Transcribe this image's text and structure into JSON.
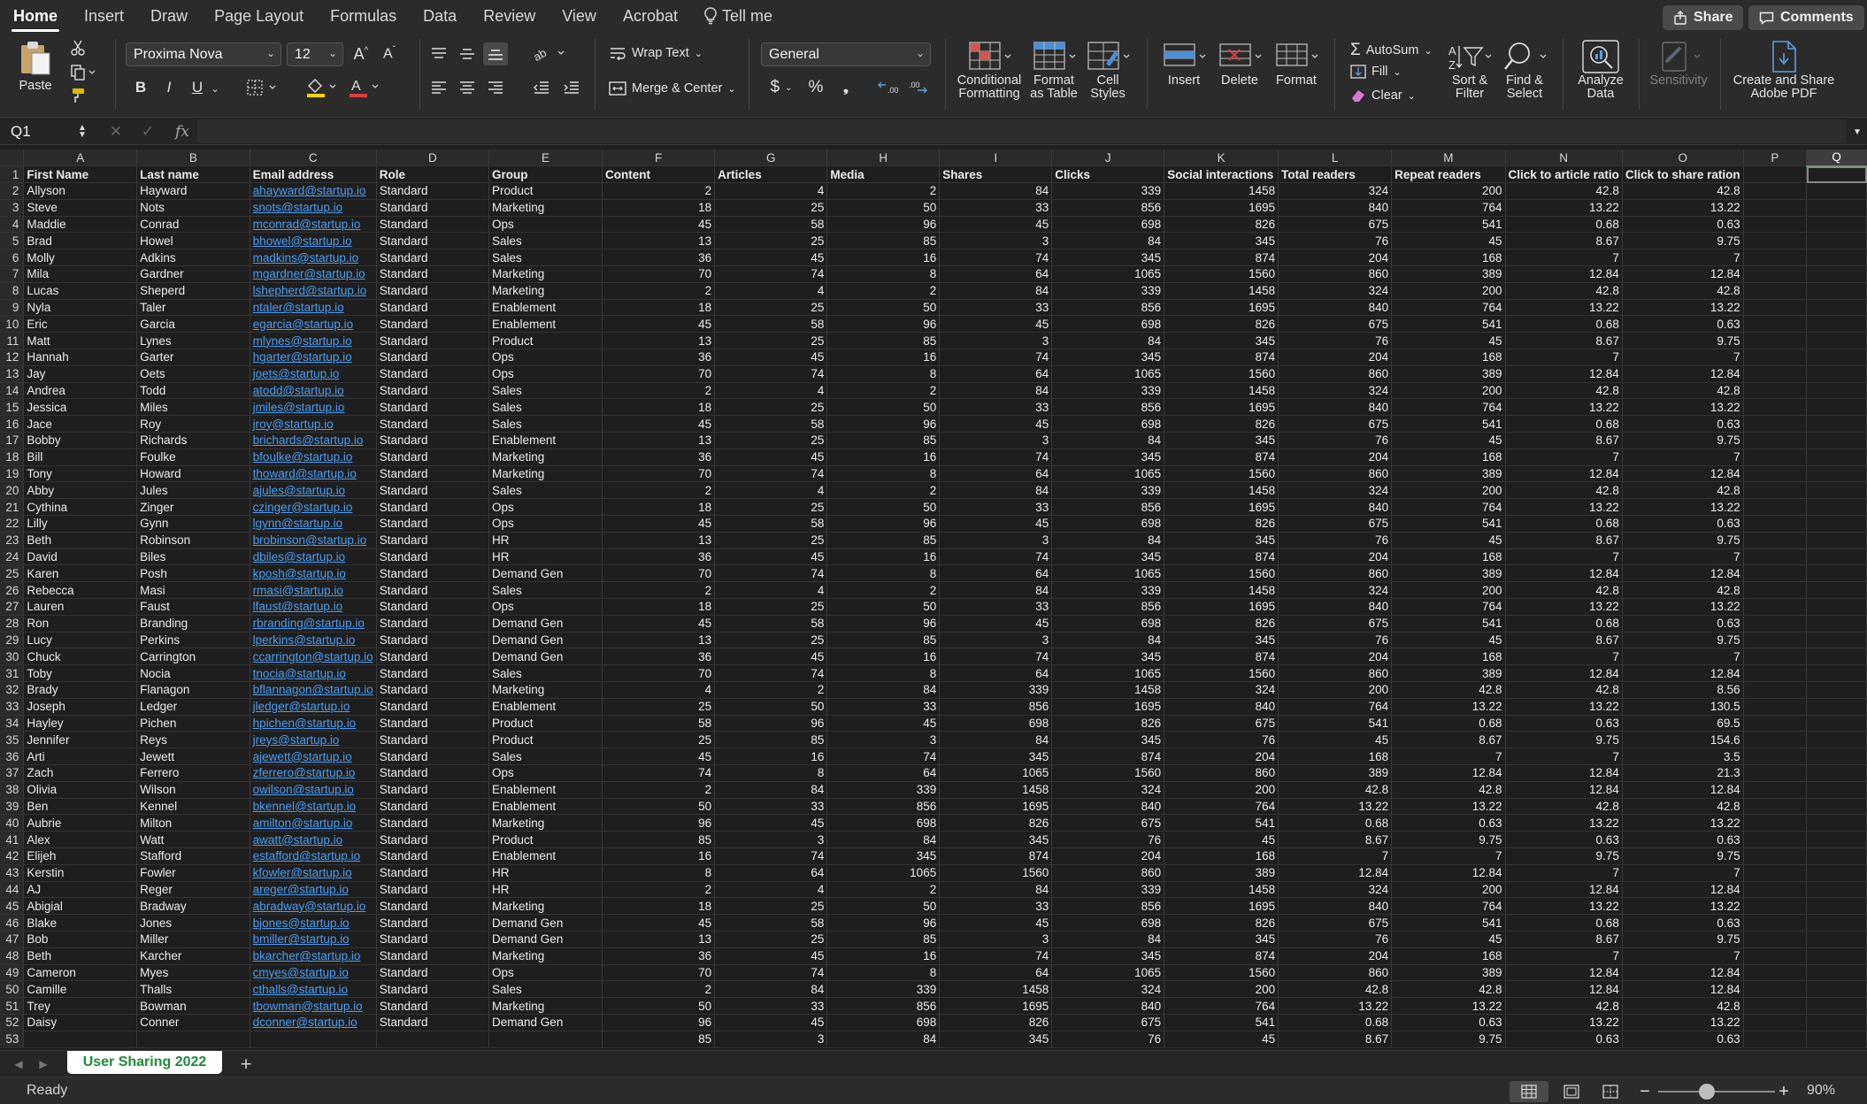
{
  "tabs": [
    "Home",
    "Insert",
    "Draw",
    "Page Layout",
    "Formulas",
    "Data",
    "Review",
    "View",
    "Acrobat"
  ],
  "tell_me": "Tell me",
  "share_label": "Share",
  "comments_label": "Comments",
  "ribbon": {
    "paste": "Paste",
    "font_name": "Proxima Nova",
    "font_size": "12",
    "wrap_text": "Wrap Text",
    "merge_center": "Merge & Center",
    "number_format": "General",
    "conditional": [
      "Conditional",
      "Formatting"
    ],
    "format_table": [
      "Format",
      "as Table"
    ],
    "cell_styles": [
      "Cell",
      "Styles"
    ],
    "insert": "Insert",
    "delete": "Delete",
    "format": "Format",
    "autosum": "AutoSum",
    "fill": "Fill",
    "clear": "Clear",
    "sort_filter": [
      "Sort &",
      "Filter"
    ],
    "find_select": [
      "Find &",
      "Select"
    ],
    "analyze": [
      "Analyze",
      "Data"
    ],
    "sensitivity": "Sensitivity",
    "create_pdf": [
      "Create and Share",
      "Adobe PDF"
    ],
    "bold": "B",
    "italic": "I",
    "underline": "U",
    "currency": "$",
    "percent": "%",
    "comma": "❯"
  },
  "formula_bar": {
    "cell_ref": "Q1",
    "fx": "fx",
    "content": ""
  },
  "columns": [
    "A",
    "B",
    "C",
    "D",
    "E",
    "F",
    "G",
    "H",
    "I",
    "J",
    "K",
    "L",
    "M",
    "N",
    "O",
    "P",
    "Q"
  ],
  "headers": [
    "First Name",
    "Last name",
    "Email address",
    "Role",
    "Group",
    "Content",
    "Articles",
    "Media",
    "Shares",
    "Clicks",
    "Social interactions",
    "Total readers",
    "Repeat readers",
    "Click to article ratio",
    "Click to share ration"
  ],
  "rows": [
    [
      "Allyson",
      "Hayward",
      "ahayward@startup.io",
      "Standard",
      "Product",
      "2",
      "4",
      "2",
      "84",
      "339",
      "1458",
      "324",
      "200",
      "42.8",
      "42.8"
    ],
    [
      "Steve",
      "Nots",
      "snots@startup.io",
      "Standard",
      "Marketing",
      "18",
      "25",
      "50",
      "33",
      "856",
      "1695",
      "840",
      "764",
      "13.22",
      "13.22"
    ],
    [
      "Maddie",
      "Conrad",
      "mconrad@startup.io",
      "Standard",
      "Ops",
      "45",
      "58",
      "96",
      "45",
      "698",
      "826",
      "675",
      "541",
      "0.68",
      "0.63"
    ],
    [
      "Brad",
      "Howel",
      "bhowel@startup.io",
      "Standard",
      "Sales",
      "13",
      "25",
      "85",
      "3",
      "84",
      "345",
      "76",
      "45",
      "8.67",
      "9.75"
    ],
    [
      "Molly",
      "Adkins",
      "madkins@startup.io",
      "Standard",
      "Sales",
      "36",
      "45",
      "16",
      "74",
      "345",
      "874",
      "204",
      "168",
      "7",
      "7"
    ],
    [
      "Mila",
      "Gardner",
      "mgardner@startup.io",
      "Standard",
      "Marketing",
      "70",
      "74",
      "8",
      "64",
      "1065",
      "1560",
      "860",
      "389",
      "12.84",
      "12.84"
    ],
    [
      "Lucas",
      "Sheperd",
      "lshepherd@startup.io",
      "Standard",
      "Marketing",
      "2",
      "4",
      "2",
      "84",
      "339",
      "1458",
      "324",
      "200",
      "42.8",
      "42.8"
    ],
    [
      "Nyla",
      "Taler",
      "ntaler@startup.io",
      "Standard",
      "Enablement",
      "18",
      "25",
      "50",
      "33",
      "856",
      "1695",
      "840",
      "764",
      "13.22",
      "13.22"
    ],
    [
      "Eric",
      "Garcia",
      "egarcia@startup.io",
      "Standard",
      "Enablement",
      "45",
      "58",
      "96",
      "45",
      "698",
      "826",
      "675",
      "541",
      "0.68",
      "0.63"
    ],
    [
      "Matt",
      "Lynes",
      "mlynes@startup.io",
      "Standard",
      "Product",
      "13",
      "25",
      "85",
      "3",
      "84",
      "345",
      "76",
      "45",
      "8.67",
      "9.75"
    ],
    [
      "Hannah",
      "Garter",
      "hgarter@startup.io",
      "Standard",
      "Ops",
      "36",
      "45",
      "16",
      "74",
      "345",
      "874",
      "204",
      "168",
      "7",
      "7"
    ],
    [
      "Jay",
      "Oets",
      "joets@startup.io",
      "Standard",
      "Ops",
      "70",
      "74",
      "8",
      "64",
      "1065",
      "1560",
      "860",
      "389",
      "12.84",
      "12.84"
    ],
    [
      "Andrea",
      "Todd",
      "atodd@startup.io",
      "Standard",
      "Sales",
      "2",
      "4",
      "2",
      "84",
      "339",
      "1458",
      "324",
      "200",
      "42.8",
      "42.8"
    ],
    [
      "Jessica",
      "Miles",
      "jmiles@startup.io",
      "Standard",
      "Sales",
      "18",
      "25",
      "50",
      "33",
      "856",
      "1695",
      "840",
      "764",
      "13.22",
      "13.22"
    ],
    [
      "Jace",
      "Roy",
      "jroy@startup.io",
      "Standard",
      "Sales",
      "45",
      "58",
      "96",
      "45",
      "698",
      "826",
      "675",
      "541",
      "0.68",
      "0.63"
    ],
    [
      "Bobby",
      "Richards",
      "brichards@startup.io",
      "Standard",
      "Enablement",
      "13",
      "25",
      "85",
      "3",
      "84",
      "345",
      "76",
      "45",
      "8.67",
      "9.75"
    ],
    [
      "Bill",
      "Foulke",
      "bfoulke@startup.io",
      "Standard",
      "Marketing",
      "36",
      "45",
      "16",
      "74",
      "345",
      "874",
      "204",
      "168",
      "7",
      "7"
    ],
    [
      "Tony",
      "Howard",
      "thoward@startup.io",
      "Standard",
      "Marketing",
      "70",
      "74",
      "8",
      "64",
      "1065",
      "1560",
      "860",
      "389",
      "12.84",
      "12.84"
    ],
    [
      "Abby",
      "Jules",
      "ajules@startup.io",
      "Standard",
      "Sales",
      "2",
      "4",
      "2",
      "84",
      "339",
      "1458",
      "324",
      "200",
      "42.8",
      "42.8"
    ],
    [
      "Cythina",
      "Zinger",
      "czinger@startup.io",
      "Standard",
      "Ops",
      "18",
      "25",
      "50",
      "33",
      "856",
      "1695",
      "840",
      "764",
      "13.22",
      "13.22"
    ],
    [
      "Lilly",
      "Gynn",
      "lgynn@startup.io",
      "Standard",
      "Ops",
      "45",
      "58",
      "96",
      "45",
      "698",
      "826",
      "675",
      "541",
      "0.68",
      "0.63"
    ],
    [
      "Beth",
      "Robinson",
      "brobinson@startup.io",
      "Standard",
      "HR",
      "13",
      "25",
      "85",
      "3",
      "84",
      "345",
      "76",
      "45",
      "8.67",
      "9.75"
    ],
    [
      "David",
      "Biles",
      "dbiles@startup.io",
      "Standard",
      "HR",
      "36",
      "45",
      "16",
      "74",
      "345",
      "874",
      "204",
      "168",
      "7",
      "7"
    ],
    [
      "Karen",
      "Posh",
      "kposh@startup.io",
      "Standard",
      "Demand Gen",
      "70",
      "74",
      "8",
      "64",
      "1065",
      "1560",
      "860",
      "389",
      "12.84",
      "12.84"
    ],
    [
      "Rebecca",
      "Masi",
      "rmasi@startup.io",
      "Standard",
      "Sales",
      "2",
      "4",
      "2",
      "84",
      "339",
      "1458",
      "324",
      "200",
      "42.8",
      "42.8"
    ],
    [
      "Lauren",
      "Faust",
      "lfaust@startup.io",
      "Standard",
      "Ops",
      "18",
      "25",
      "50",
      "33",
      "856",
      "1695",
      "840",
      "764",
      "13.22",
      "13.22"
    ],
    [
      "Ron",
      "Branding",
      "rbranding@startup.io",
      "Standard",
      "Demand Gen",
      "45",
      "58",
      "96",
      "45",
      "698",
      "826",
      "675",
      "541",
      "0.68",
      "0.63"
    ],
    [
      "Lucy",
      "Perkins",
      "lperkins@startup.io",
      "Standard",
      "Demand Gen",
      "13",
      "25",
      "85",
      "3",
      "84",
      "345",
      "76",
      "45",
      "8.67",
      "9.75"
    ],
    [
      "Chuck",
      "Carrington",
      "ccarrington@startup.io",
      "Standard",
      "Demand Gen",
      "36",
      "45",
      "16",
      "74",
      "345",
      "874",
      "204",
      "168",
      "7",
      "7"
    ],
    [
      "Toby",
      "Nocia",
      "tnocia@startup.io",
      "Standard",
      "Sales",
      "70",
      "74",
      "8",
      "64",
      "1065",
      "1560",
      "860",
      "389",
      "12.84",
      "12.84"
    ],
    [
      "Brady",
      "Flanagon",
      "bflannagon@startup.io",
      "Standard",
      "Marketing",
      "4",
      "2",
      "84",
      "339",
      "1458",
      "324",
      "200",
      "42.8",
      "42.8",
      "8.56"
    ],
    [
      "Joseph",
      "Ledger",
      "jledger@startup.io",
      "Standard",
      "Enablement",
      "25",
      "50",
      "33",
      "856",
      "1695",
      "840",
      "764",
      "13.22",
      "13.22",
      "130.5"
    ],
    [
      "Hayley",
      "Pichen",
      "hpichen@startup.io",
      "Standard",
      "Product",
      "58",
      "96",
      "45",
      "698",
      "826",
      "675",
      "541",
      "0.68",
      "0.63",
      "69.5"
    ],
    [
      "Jennifer",
      "Reys",
      "jreys@startup.io",
      "Standard",
      "Product",
      "25",
      "85",
      "3",
      "84",
      "345",
      "76",
      "45",
      "8.67",
      "9.75",
      "154.6"
    ],
    [
      "Arti",
      "Jewett",
      "ajewett@startup.io",
      "Standard",
      "Sales",
      "45",
      "16",
      "74",
      "345",
      "874",
      "204",
      "168",
      "7",
      "7",
      "3.5"
    ],
    [
      "Zach",
      "Ferrero",
      "zferrero@startup.io",
      "Standard",
      "Ops",
      "74",
      "8",
      "64",
      "1065",
      "1560",
      "860",
      "389",
      "12.84",
      "12.84",
      "21.3"
    ],
    [
      "Olivia",
      "Wilson",
      "owilson@startup.io",
      "Standard",
      "Enablement",
      "2",
      "84",
      "339",
      "1458",
      "324",
      "200",
      "42.8",
      "42.8",
      "12.84",
      "12.84"
    ],
    [
      "Ben",
      "Kennel",
      "bkennel@startup.io",
      "Standard",
      "Enablement",
      "50",
      "33",
      "856",
      "1695",
      "840",
      "764",
      "13.22",
      "13.22",
      "42.8",
      "42.8"
    ],
    [
      "Aubrie",
      "Milton",
      "amilton@startup.io",
      "Standard",
      "Marketing",
      "96",
      "45",
      "698",
      "826",
      "675",
      "541",
      "0.68",
      "0.63",
      "13.22",
      "13.22"
    ],
    [
      "Alex",
      "Watt",
      "awatt@startup.io",
      "Standard",
      "Product",
      "85",
      "3",
      "84",
      "345",
      "76",
      "45",
      "8.67",
      "9.75",
      "0.63",
      "0.63"
    ],
    [
      "Elijeh",
      "Stafford",
      "estafford@startup.io",
      "Standard",
      "Enablement",
      "16",
      "74",
      "345",
      "874",
      "204",
      "168",
      "7",
      "7",
      "9.75",
      "9.75"
    ],
    [
      "Kerstin",
      "Fowler",
      "kfowler@startup.io",
      "Standard",
      "HR",
      "8",
      "64",
      "1065",
      "1560",
      "860",
      "389",
      "12.84",
      "12.84",
      "7",
      "7"
    ],
    [
      "AJ",
      "Reger",
      "areger@startup.io",
      "Standard",
      "HR",
      "2",
      "4",
      "2",
      "84",
      "339",
      "1458",
      "324",
      "200",
      "12.84",
      "12.84"
    ],
    [
      "Abigial",
      "Bradway",
      "abradway@startup.io",
      "Standard",
      "Marketing",
      "18",
      "25",
      "50",
      "33",
      "856",
      "1695",
      "840",
      "764",
      "13.22",
      "13.22"
    ],
    [
      "Blake",
      "Jones",
      "bjones@startup.io",
      "Standard",
      "Demand Gen",
      "45",
      "58",
      "96",
      "45",
      "698",
      "826",
      "675",
      "541",
      "0.68",
      "0.63"
    ],
    [
      "Bob",
      "Miller",
      "bmiller@startup.io",
      "Standard",
      "Demand Gen",
      "13",
      "25",
      "85",
      "3",
      "84",
      "345",
      "76",
      "45",
      "8.67",
      "9.75"
    ],
    [
      "Beth",
      "Karcher",
      "bkarcher@startup.io",
      "Standard",
      "Marketing",
      "36",
      "45",
      "16",
      "74",
      "345",
      "874",
      "204",
      "168",
      "7",
      "7"
    ],
    [
      "Cameron",
      "Myes",
      "cmyes@startup.io",
      "Standard",
      "Ops",
      "70",
      "74",
      "8",
      "64",
      "1065",
      "1560",
      "860",
      "389",
      "12.84",
      "12.84"
    ],
    [
      "Camille",
      "Thalls",
      "cthalls@startup.io",
      "Standard",
      "Sales",
      "2",
      "84",
      "339",
      "1458",
      "324",
      "200",
      "42.8",
      "42.8",
      "12.84",
      "12.84"
    ],
    [
      "Trey",
      "Bowman",
      "tbowman@startup.io",
      "Standard",
      "Marketing",
      "50",
      "33",
      "856",
      "1695",
      "840",
      "764",
      "13.22",
      "13.22",
      "42.8",
      "42.8"
    ],
    [
      "Daisy",
      "Conner",
      "dconner@startup.io",
      "Standard",
      "Demand Gen",
      "96",
      "45",
      "698",
      "826",
      "675",
      "541",
      "0.68",
      "0.63",
      "13.22",
      "13.22"
    ],
    [
      "",
      "",
      "",
      "",
      "",
      "85",
      "3",
      "84",
      "345",
      "76",
      "45",
      "8.67",
      "9.75",
      "0.63",
      "0.63"
    ]
  ],
  "sheet_tab": "User Sharing 2022",
  "status": {
    "text": "Ready",
    "zoom": "90%"
  },
  "colors": {
    "accent_green": "#1f8a3a",
    "link_blue": "#4a9ff5",
    "fill_yellow": "#f2d600",
    "font_red": "#e23b3b"
  },
  "icons": [
    "clipboard-icon",
    "scissors-icon",
    "copy-icon",
    "format-painter-icon",
    "lightbulb-icon",
    "share-icon",
    "comment-icon",
    "sum-icon",
    "fill-down-icon",
    "eraser-icon",
    "sort-filter-icon",
    "magnifier-icon",
    "analyze-icon",
    "sensitivity-icon",
    "pdf-icon"
  ]
}
